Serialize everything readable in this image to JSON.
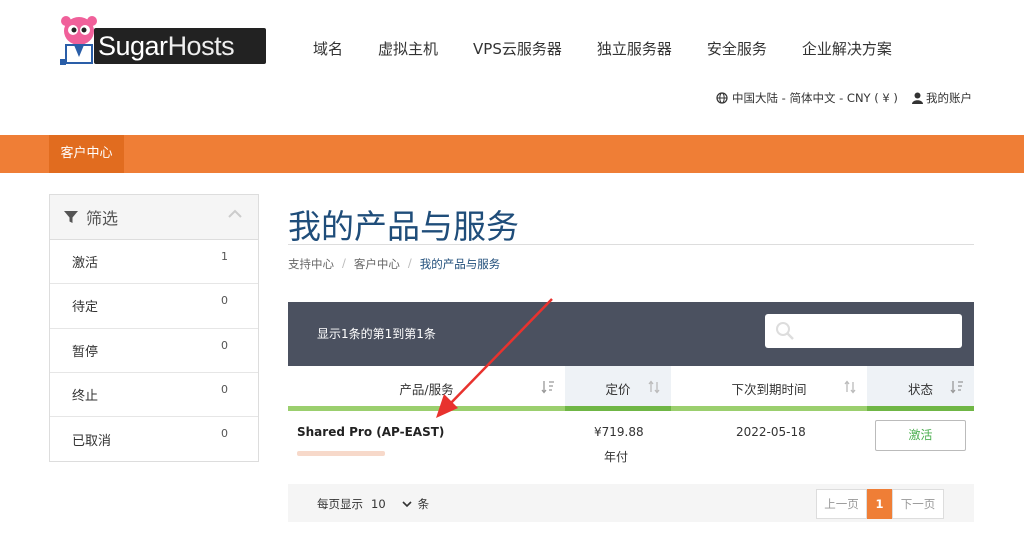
{
  "brand": {
    "part1": "Sugar",
    "part2": "Hosts"
  },
  "nav": [
    "域名",
    "虚拟主机",
    "VPS云服务器",
    "独立服务器",
    "安全服务",
    "企业解决方案"
  ],
  "utility": {
    "locale": "中国大陆 - 简体中文 - CNY ( ¥ )",
    "account": "我的账户"
  },
  "orange_tab": "客户中心",
  "sidebar": {
    "title": "筛选",
    "items": [
      {
        "label": "激活",
        "count": "1"
      },
      {
        "label": "待定",
        "count": "0"
      },
      {
        "label": "暂停",
        "count": "0"
      },
      {
        "label": "终止",
        "count": "0"
      },
      {
        "label": "已取消",
        "count": "0"
      }
    ]
  },
  "page": {
    "title": "我的产品与服务",
    "breadcrumb": [
      "支持中心",
      "客户中心",
      "我的产品与服务"
    ]
  },
  "table": {
    "summary": "显示1条的第1到第1条",
    "columns": [
      "产品/服务",
      "定价",
      "下次到期时间",
      "状态"
    ],
    "rows": [
      {
        "product": "Shared Pro (AP-EAST)",
        "price": "¥719.88",
        "cycle": "年付",
        "due": "2022-05-18",
        "status": "激活"
      }
    ]
  },
  "footer": {
    "per_page_label": "每页显示",
    "per_page_value": "10",
    "per_page_unit": "条",
    "prev": "上一页",
    "current": "1",
    "next": "下一页"
  },
  "colors": {
    "orange": "#ef7e36",
    "navy": "#1f4d7a",
    "table_head": "#4b5160",
    "green": "#6fb645"
  }
}
